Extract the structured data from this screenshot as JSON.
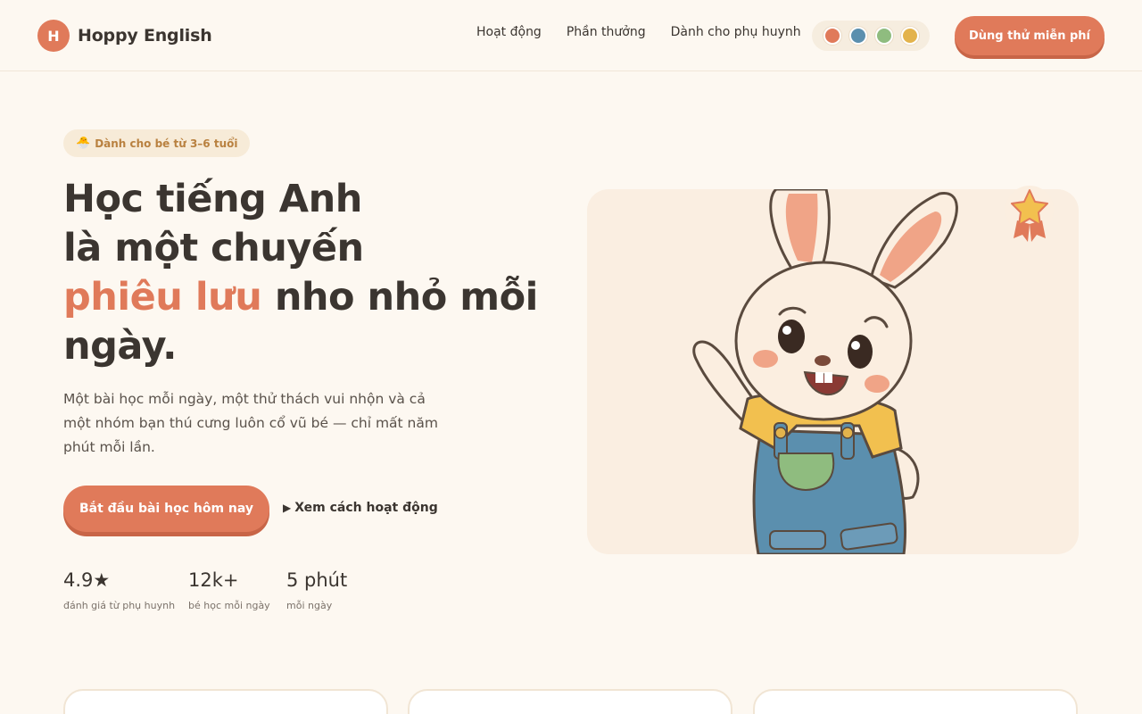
{
  "header": {
    "logo_letter": "H",
    "brand": "Hoppy English",
    "nav": [
      "Hoạt động",
      "Phần thưởng",
      "Dành cho phụ huynh"
    ],
    "theme_colors": [
      "#e07a5a",
      "#5b8fae",
      "#8fbc7f",
      "#e3b34c"
    ],
    "trial_button": "Dùng thử miễn phí"
  },
  "hero": {
    "badge_icon": "🐣",
    "badge": "Dành cho bé từ 3–6 tuổi",
    "title_line1": "Học tiếng Anh",
    "title_line2": "là một chuyến",
    "title_accent": "phiêu lưu",
    "title_line3_rest": " nho nhỏ mỗi",
    "title_line4": "ngày.",
    "description": "Một bài học mỗi ngày, một thử thách vui nhộn và cả một nhóm bạn thú cưng luôn cổ vũ bé — chỉ mất năm phút mỗi lần.",
    "primary_cta": "Bắt đầu bài học hôm nay",
    "secondary_cta_icon": "▶",
    "secondary_cta": "Xem cách hoạt động"
  },
  "stats": [
    {
      "value": "4.9★",
      "label": "đánh giá từ phụ huynh"
    },
    {
      "value": "12k+",
      "label": "bé học mỗi ngày"
    },
    {
      "value": "5 phút",
      "label": "mỗi ngày"
    }
  ],
  "colors": {
    "accent": "#e07a5a",
    "background": "#fdf8f1",
    "text": "#3b3530"
  }
}
